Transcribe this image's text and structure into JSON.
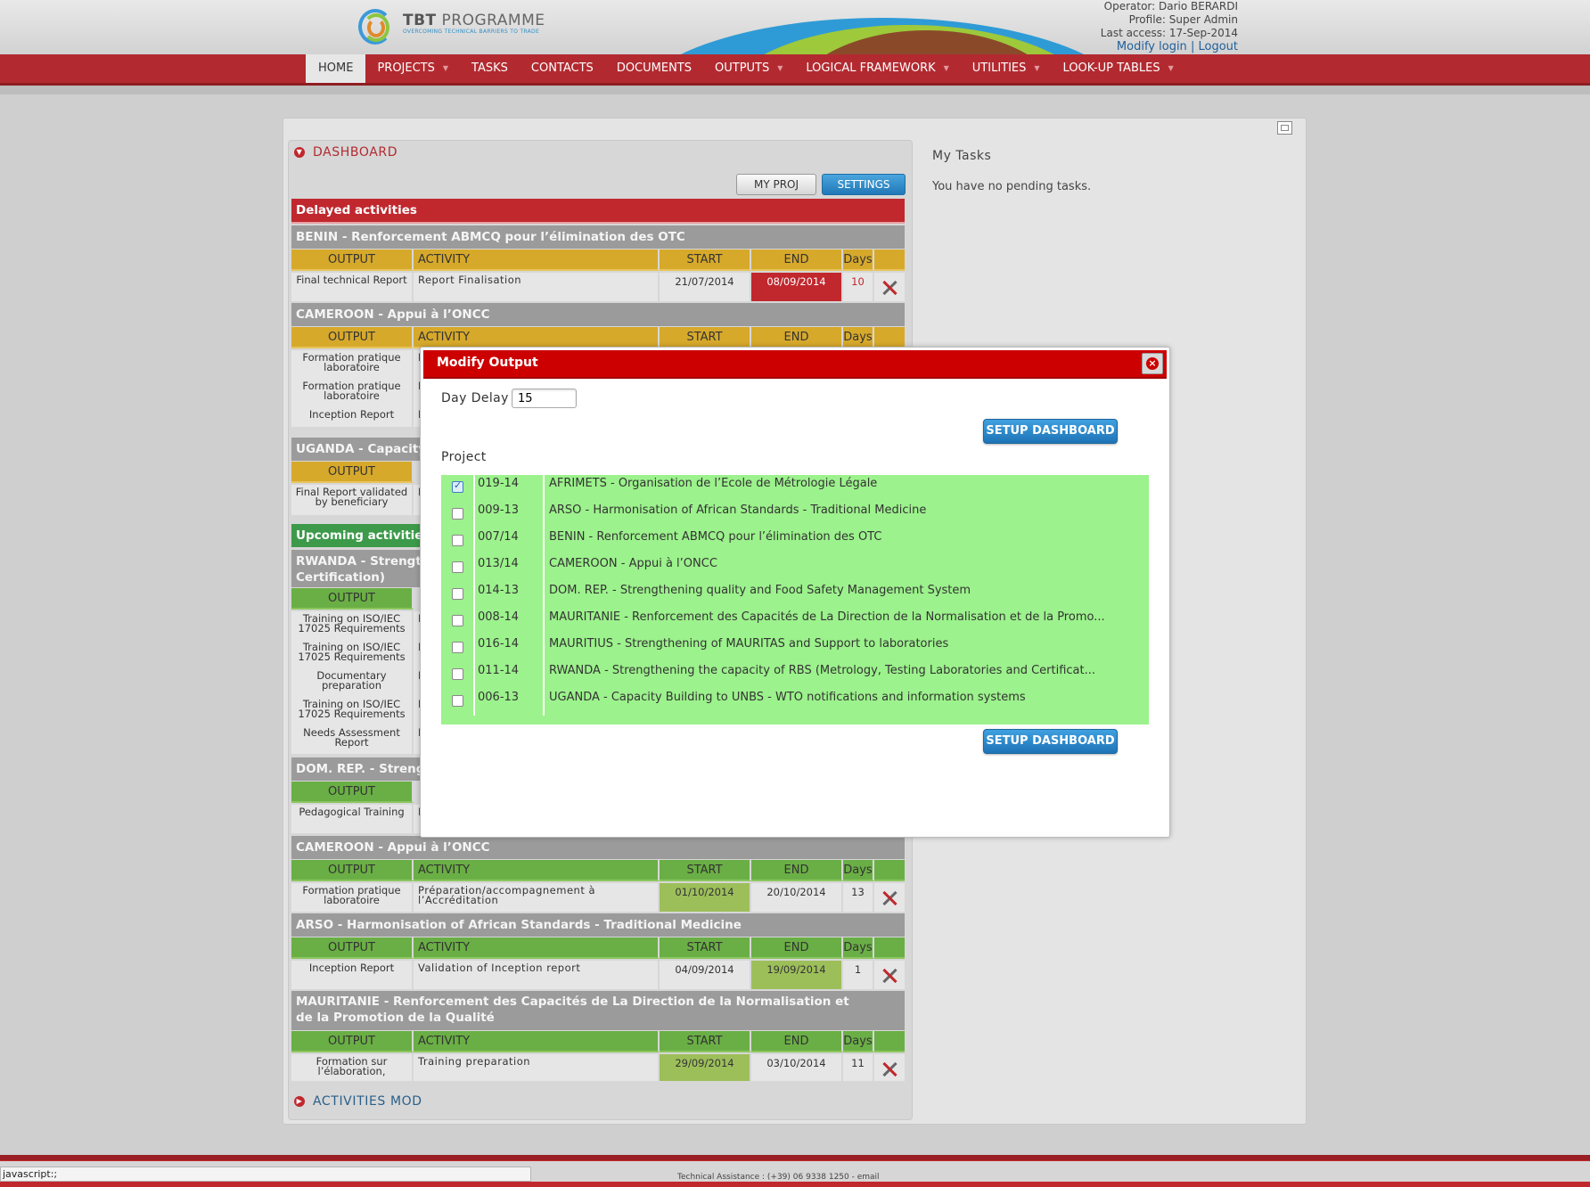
{
  "header": {
    "logo_title_bold": "TBT",
    "logo_title_rest": " PROGRAMME",
    "logo_tagline": "OVERCOMING TECHNICAL BARRIERS TO TRADE",
    "operator": "Operator: Dario BERARDI",
    "profile": "Profile: Super Admin",
    "last_access": "Last access: 17-Sep-2014",
    "modify_login": "Modify login",
    "separator": "|",
    "logout": "Logout"
  },
  "nav": {
    "home": "HOME",
    "projects": "PROJECTS",
    "tasks": "TASKS",
    "contacts": "CONTACTS",
    "documents": "DOCUMENTS",
    "outputs": "OUTPUTS",
    "logical_framework": "LOGICAL FRAMEWORK",
    "utilities": "UTILITIES",
    "lookup_tables": "LOOK-UP TABLES"
  },
  "dashboard": {
    "title": "DASHBOARD",
    "my_proj": "MY PROJ",
    "settings": "SETTINGS",
    "delayed": "Delayed activities",
    "upcoming": "Upcoming activities",
    "activities_mod": "ACTIVITIES MOD",
    "cols": {
      "output": "OUTPUT",
      "activity": "ACTIVITY",
      "start": "START",
      "end": "END",
      "days": "Days"
    },
    "g_benin": "BENIN - Renforcement ABMCQ pour l’élimination des OTC",
    "benin_row": {
      "output": "Final technical Report",
      "activity": "Report Finalisation",
      "start": "21/07/2014",
      "end": "08/09/2014",
      "days": "10"
    },
    "g_cameroon": "CAMEROON - Appui à l’ONCC",
    "cam_out1": "Formation pratique laboratoire",
    "cam_out2": "Formation pratique laboratoire",
    "cam_out3": "Inception Report",
    "cam_act1": "F",
    "cam_act2": "F",
    "cam_act3": "I",
    "g_uganda": "UGANDA - Capacity",
    "uga_out": "Final Report validated by beneficiary",
    "uga_act": "F",
    "g_rwanda": "RWANDA - Strength Certification)",
    "rw_out1": "Training on ISO/IEC 17025 Requirements",
    "rw_out2": "Training on ISO/IEC 17025 Requirements",
    "rw_out3": "Documentary preparation",
    "rw_out4": "Training on ISO/IEC 17025 Requirements",
    "rw_out5": "Needs Assessment Report",
    "rw_act": "I",
    "g_domrep": "DOM. REP. - Streng",
    "dr_out": "Pedagogical Training",
    "dr_act": "I",
    "g_cameroon2": "CAMEROON - Appui à l’ONCC",
    "cam2_row": {
      "output": "Formation pratique laboratoire",
      "activity": "Préparation/accompagnement à l’Accréditation",
      "start": "01/10/2014",
      "end": "20/10/2014",
      "days": "13"
    },
    "g_arso": "ARSO - Harmonisation of African Standards - Traditional Medicine",
    "arso_row": {
      "output": "Inception Report",
      "activity": "Validation of Inception report",
      "start": "04/09/2014",
      "end": "19/09/2014",
      "days": "1"
    },
    "g_mauritanie": "MAURITANIE - Renforcement des Capacités de La Direction de la Normalisation et de la Promotion de la Qualité",
    "maur_row": {
      "output": "Formation sur l’élaboration,",
      "activity": "Training preparation",
      "start": "29/09/2014",
      "end": "03/10/2014",
      "days": "11"
    }
  },
  "tasks": {
    "title": "My Tasks",
    "empty": "You have no pending tasks."
  },
  "modal": {
    "title": "Modify Output",
    "close": "×",
    "day_delay_label": "Day Delay",
    "day_delay_value": "15",
    "setup_button": "SETUP DASHBOARD",
    "project_label": "Project",
    "projects": [
      {
        "code": "019-14",
        "name": "AFRIMETS - Organisation de l’Ecole de Métrologie Légale",
        "checked": true
      },
      {
        "code": "009-13",
        "name": "ARSO - Harmonisation of African Standards - Traditional Medicine",
        "checked": false
      },
      {
        "code": "007/14",
        "name": "BENIN - Renforcement ABMCQ pour l’élimination des OTC",
        "checked": false
      },
      {
        "code": "013/14",
        "name": "CAMEROON - Appui à l’ONCC",
        "checked": false
      },
      {
        "code": "014-13",
        "name": "DOM. REP. - Strengthening quality and Food Safety Management System",
        "checked": false
      },
      {
        "code": "008-14",
        "name": "MAURITANIE - Renforcement des Capacités de La Direction de la Normalisation et de la Promo...",
        "checked": false
      },
      {
        "code": "016-14",
        "name": "MAURITIUS - Strengthening of MAURITAS and Support to laboratories",
        "checked": false
      },
      {
        "code": "011-14",
        "name": "RWANDA - Strengthening the capacity of RBS (Metrology, Testing Laboratories and Certificat...",
        "checked": false
      },
      {
        "code": "006-13",
        "name": "UGANDA - Capacity Building to UNBS - WTO notifications and information systems",
        "checked": false
      }
    ]
  },
  "status_bar": "javascript:;",
  "footer_text": "Technical Assistance : (+39) 06 9338 1250 - email",
  "colors": {
    "nav_red": "#b22a30",
    "modal_red": "#cc0000",
    "project_green": "#9cf28c",
    "setup_blue": "#1e74b6"
  }
}
